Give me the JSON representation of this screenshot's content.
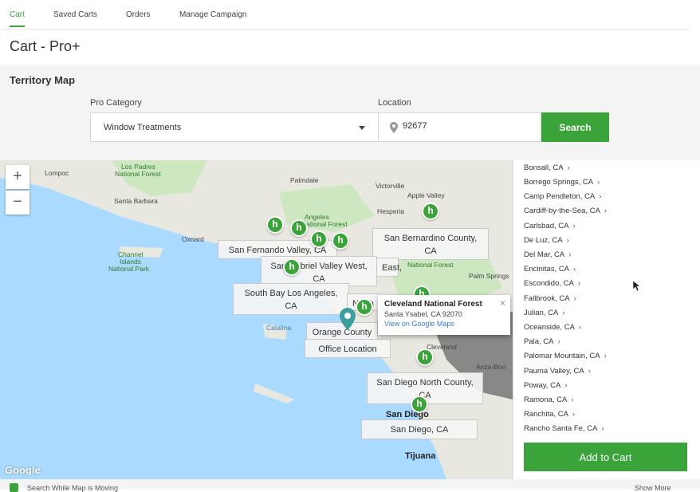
{
  "tabs": [
    {
      "label": "Cart"
    },
    {
      "label": "Saved Carts"
    },
    {
      "label": "Orders"
    },
    {
      "label": "Manage Campaign"
    }
  ],
  "page_title": "Cart - Pro+",
  "section_title": "Territory Map",
  "pro_category": {
    "label": "Pro Category",
    "value": "Window Treatments"
  },
  "location": {
    "label": "Location",
    "value": "92677",
    "icon": "map-pin-icon"
  },
  "search_label": "Search",
  "map": {
    "zoom_in": "+",
    "zoom_out": "−",
    "google": "Google",
    "labels": {
      "lompoc": "Lompoc",
      "los_padres": "Los Padres",
      "national_forest_1": "National Forest",
      "santa_barbara": "Santa Barbara",
      "oxnard": "Oxnard",
      "channel": "Channel",
      "islands": "Islands",
      "national_park": "National Park",
      "palmdale": "Palmdale",
      "victorville": "Victorville",
      "apple_valley": "Apple Valley",
      "hesperia": "Hesperia",
      "angeles": "Angeles",
      "national_forest_2": "National Forest",
      "national_forest_3": "National Forest",
      "palm_springs": "Palm Springs",
      "catalina": "Catalina",
      "san_diego_city": "San Diego",
      "tijuana": "Tijuana",
      "anza": "Anza-Borr",
      "cleveland": "Cleveland"
    },
    "territories": {
      "sfv": "San Fernando Valley, CA",
      "sbc": "San Bernardino County, CA",
      "sgv": "San Gabriel Valley West, CA",
      "east": "East,",
      "sbla": "South Bay Los Angeles, CA",
      "oc": "Orange County",
      "north": "North",
      "office": "Office Location",
      "sdn": "San Diego North County, CA",
      "sd": "San Diego, CA"
    },
    "infowindow": {
      "title": "Cleveland National Forest",
      "address": "Santa Ysabel, CA 92070",
      "link": "View on Google Maps",
      "close": "×"
    }
  },
  "cities": [
    "Bonsall, CA",
    "Borrego Springs, CA",
    "Camp Pendleton, CA",
    "Cardiff-by-the-Sea, CA",
    "Carlsbad, CA",
    "De Luz, CA",
    "Del Mar, CA",
    "Encinitas, CA",
    "Escondido, CA",
    "Fallbrook, CA",
    "Julian, CA",
    "Oceanside, CA",
    "Pala, CA",
    "Palomar Mountain, CA",
    "Pauma Valley, CA",
    "Poway, CA",
    "Ramona, CA",
    "Ranchita, CA",
    "Rancho Santa Fe, CA"
  ],
  "add_to_cart_label": "Add to Cart",
  "bottom": {
    "left": "Search While Map is Moving",
    "right": "Show More"
  },
  "colors": {
    "accent": "#3aa43a",
    "water": "#aadaff",
    "land": "#e8e8e0",
    "park": "#cde8c0"
  }
}
